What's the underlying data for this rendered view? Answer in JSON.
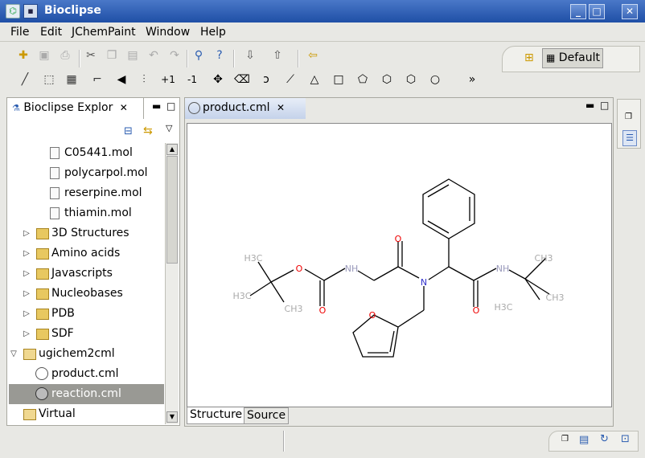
{
  "window": {
    "title": "Bioclipse",
    "menu_icon": "▪",
    "minimize": "_",
    "maximize": "□",
    "close": "✕"
  },
  "menus": [
    "File",
    "Edit",
    "JChemPaint",
    "Window",
    "Help"
  ],
  "perspective": {
    "label": "Default"
  },
  "explorer": {
    "title": "Bioclipse Explor",
    "items": [
      {
        "label": "C05441.mol",
        "type": "file"
      },
      {
        "label": "polycarpol.mol",
        "type": "file"
      },
      {
        "label": "reserpine.mol",
        "type": "file"
      },
      {
        "label": "thiamin.mol",
        "type": "file"
      },
      {
        "label": "3D Structures",
        "type": "folder"
      },
      {
        "label": "Amino acids",
        "type": "folder"
      },
      {
        "label": "Javascripts",
        "type": "folder"
      },
      {
        "label": "Nucleobases",
        "type": "folder"
      },
      {
        "label": "PDB",
        "type": "folder"
      },
      {
        "label": "SDF",
        "type": "folder"
      },
      {
        "label": "ugichem2cml",
        "type": "folder-open"
      },
      {
        "label": "product.cml",
        "type": "cml"
      },
      {
        "label": "reaction.cml",
        "type": "cml",
        "selected": true
      },
      {
        "label": "Virtual",
        "type": "virtual"
      }
    ]
  },
  "editor": {
    "tab": "product.cml",
    "bottom_tabs": [
      "Structure",
      "Source"
    ]
  },
  "toolbar2": {
    "plus_one": "+1",
    "minus_one": "-1",
    "more": "»"
  },
  "molecule": {
    "labels": {
      "o1": "O",
      "o2": "O",
      "o3": "O",
      "o4": "O",
      "o5": "O",
      "n1": "N",
      "n2": "NH",
      "n3": "N",
      "n4": "NH",
      "h3c_a": "H3C",
      "h3c_b": "H3C",
      "ch3_a": "CH3",
      "ch3_b": "CH3",
      "h3c_c": "H3C",
      "ch3_c": "CH3"
    }
  }
}
